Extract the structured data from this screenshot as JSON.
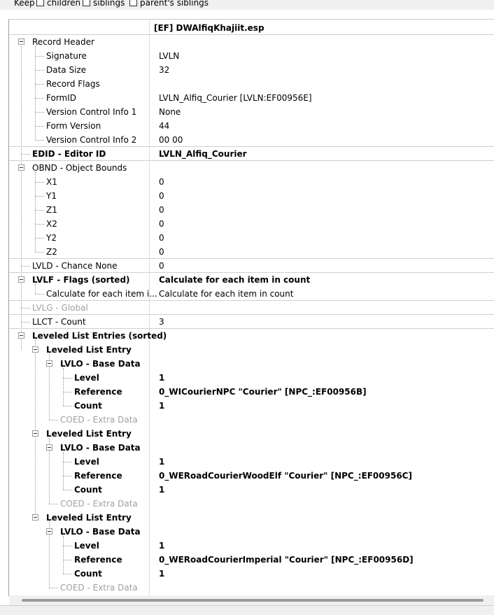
{
  "keep_bar": {
    "keep_label": "Keep",
    "children_label": "children",
    "siblings_label": "siblings",
    "parent_siblings_label": "parent's siblings"
  },
  "file_header": "[EF] DWAlfiqKhajiit.esp",
  "rows": [
    {
      "label": "Record Header",
      "value": ""
    },
    {
      "label": "Signature",
      "value": "LVLN"
    },
    {
      "label": "Data Size",
      "value": "32"
    },
    {
      "label": "Record Flags",
      "value": ""
    },
    {
      "label": "FormID",
      "value": "LVLN_Alfiq_Courier [LVLN:EF00956E]"
    },
    {
      "label": "Version Control Info 1",
      "value": "None"
    },
    {
      "label": "Form Version",
      "value": "44"
    },
    {
      "label": "Version Control Info 2",
      "value": "00 00"
    },
    {
      "label": "EDID - Editor ID",
      "value": "LVLN_Alfiq_Courier"
    },
    {
      "label": "OBND - Object Bounds",
      "value": ""
    },
    {
      "label": "X1",
      "value": "0"
    },
    {
      "label": "Y1",
      "value": "0"
    },
    {
      "label": "Z1",
      "value": "0"
    },
    {
      "label": "X2",
      "value": "0"
    },
    {
      "label": "Y2",
      "value": "0"
    },
    {
      "label": "Z2",
      "value": "0"
    },
    {
      "label": "LVLD - Chance None",
      "value": "0"
    },
    {
      "label": "LVLF - Flags (sorted)",
      "value": "Calculate for each item in count"
    },
    {
      "label": "Calculate for each item i...",
      "value": "Calculate for each item in count"
    },
    {
      "label": "LVLG - Global",
      "value": ""
    },
    {
      "label": "LLCT - Count",
      "value": "3"
    },
    {
      "label": "Leveled List Entries (sorted)",
      "value": ""
    },
    {
      "label": "Leveled List Entry",
      "value": ""
    },
    {
      "label": "LVLO - Base Data",
      "value": ""
    },
    {
      "label": "Level",
      "value": "1"
    },
    {
      "label": "Reference",
      "value": "0_WICourierNPC \"Courier\" [NPC_:EF00956B]"
    },
    {
      "label": "Count",
      "value": "1"
    },
    {
      "label": "COED - Extra Data",
      "value": ""
    },
    {
      "label": "Leveled List Entry",
      "value": ""
    },
    {
      "label": "LVLO - Base Data",
      "value": ""
    },
    {
      "label": "Level",
      "value": "1"
    },
    {
      "label": "Reference",
      "value": "0_WERoadCourierWoodElf \"Courier\" [NPC_:EF00956C]"
    },
    {
      "label": "Count",
      "value": "1"
    },
    {
      "label": "COED - Extra Data",
      "value": ""
    },
    {
      "label": "Leveled List Entry",
      "value": ""
    },
    {
      "label": "LVLO - Base Data",
      "value": ""
    },
    {
      "label": "Level",
      "value": "1"
    },
    {
      "label": "Reference",
      "value": "0_WERoadCourierImperial \"Courier\" [NPC_:EF00956D]"
    },
    {
      "label": "Count",
      "value": "1"
    },
    {
      "label": "COED - Extra Data",
      "value": ""
    }
  ]
}
